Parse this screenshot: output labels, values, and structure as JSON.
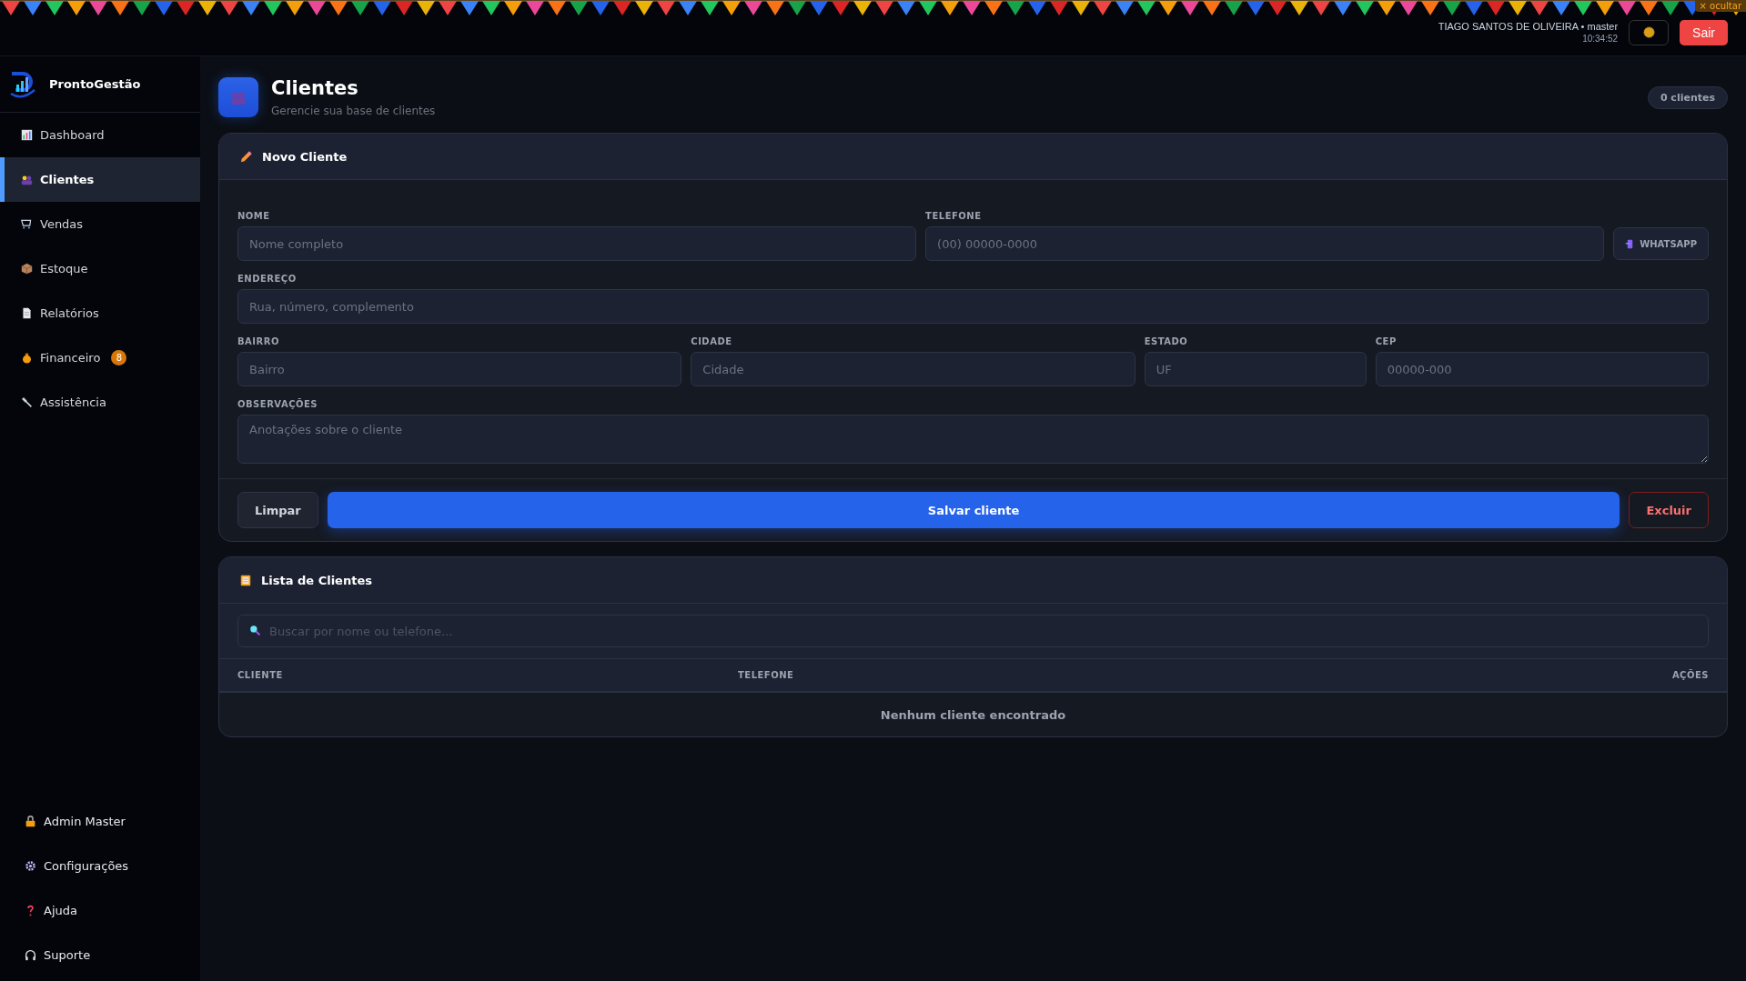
{
  "topbar": {
    "hide_label": "× ocultar",
    "user": "TIAGO SANTOS DE OLIVEIRA • master",
    "time": "10:34:52",
    "logout": "Sair"
  },
  "sidebar": {
    "brand": "ProntoGestão",
    "items": [
      {
        "label": "Dashboard",
        "selected": false
      },
      {
        "label": "Clientes",
        "selected": true
      },
      {
        "label": "Vendas",
        "selected": false
      },
      {
        "label": "Estoque",
        "selected": false
      },
      {
        "label": "Relatórios",
        "selected": false
      },
      {
        "label": "Financeiro",
        "selected": false,
        "badge": "8"
      },
      {
        "label": "Assistência",
        "selected": false
      }
    ],
    "footer_items": [
      {
        "label": "Admin Master"
      },
      {
        "label": "Configurações"
      },
      {
        "label": "Ajuda"
      },
      {
        "label": "Suporte"
      }
    ]
  },
  "page": {
    "title": "Clientes",
    "subtitle": "Gerencie sua base de clientes",
    "count": "0 clientes"
  },
  "form": {
    "title": "Novo Cliente",
    "name": {
      "label": "NOME",
      "placeholder": "Nome completo"
    },
    "phone": {
      "label": "TELEFONE",
      "placeholder": "(00) 00000-0000",
      "action": "WHATSAPP"
    },
    "address": {
      "label": "ENDEREÇO",
      "placeholder": "Rua, número, complemento"
    },
    "district": {
      "label": "BAIRRO",
      "placeholder": "Bairro"
    },
    "city": {
      "label": "CIDADE",
      "placeholder": "Cidade"
    },
    "state": {
      "label": "ESTADO",
      "placeholder": "UF"
    },
    "zip": {
      "label": "CEP",
      "placeholder": "00000-000"
    },
    "notes": {
      "label": "OBSERVAÇÕES",
      "placeholder": "Anotações sobre o cliente"
    },
    "buttons": {
      "clear": "Limpar",
      "save": "Salvar cliente",
      "delete": "Excluir"
    }
  },
  "list": {
    "title": "Lista de Clientes",
    "search_placeholder": "Buscar por nome ou telefone...",
    "columns": [
      "CLIENTE",
      "TELEFONE",
      "AÇÕES"
    ],
    "empty_message": "Nenhum cliente encontrado"
  }
}
